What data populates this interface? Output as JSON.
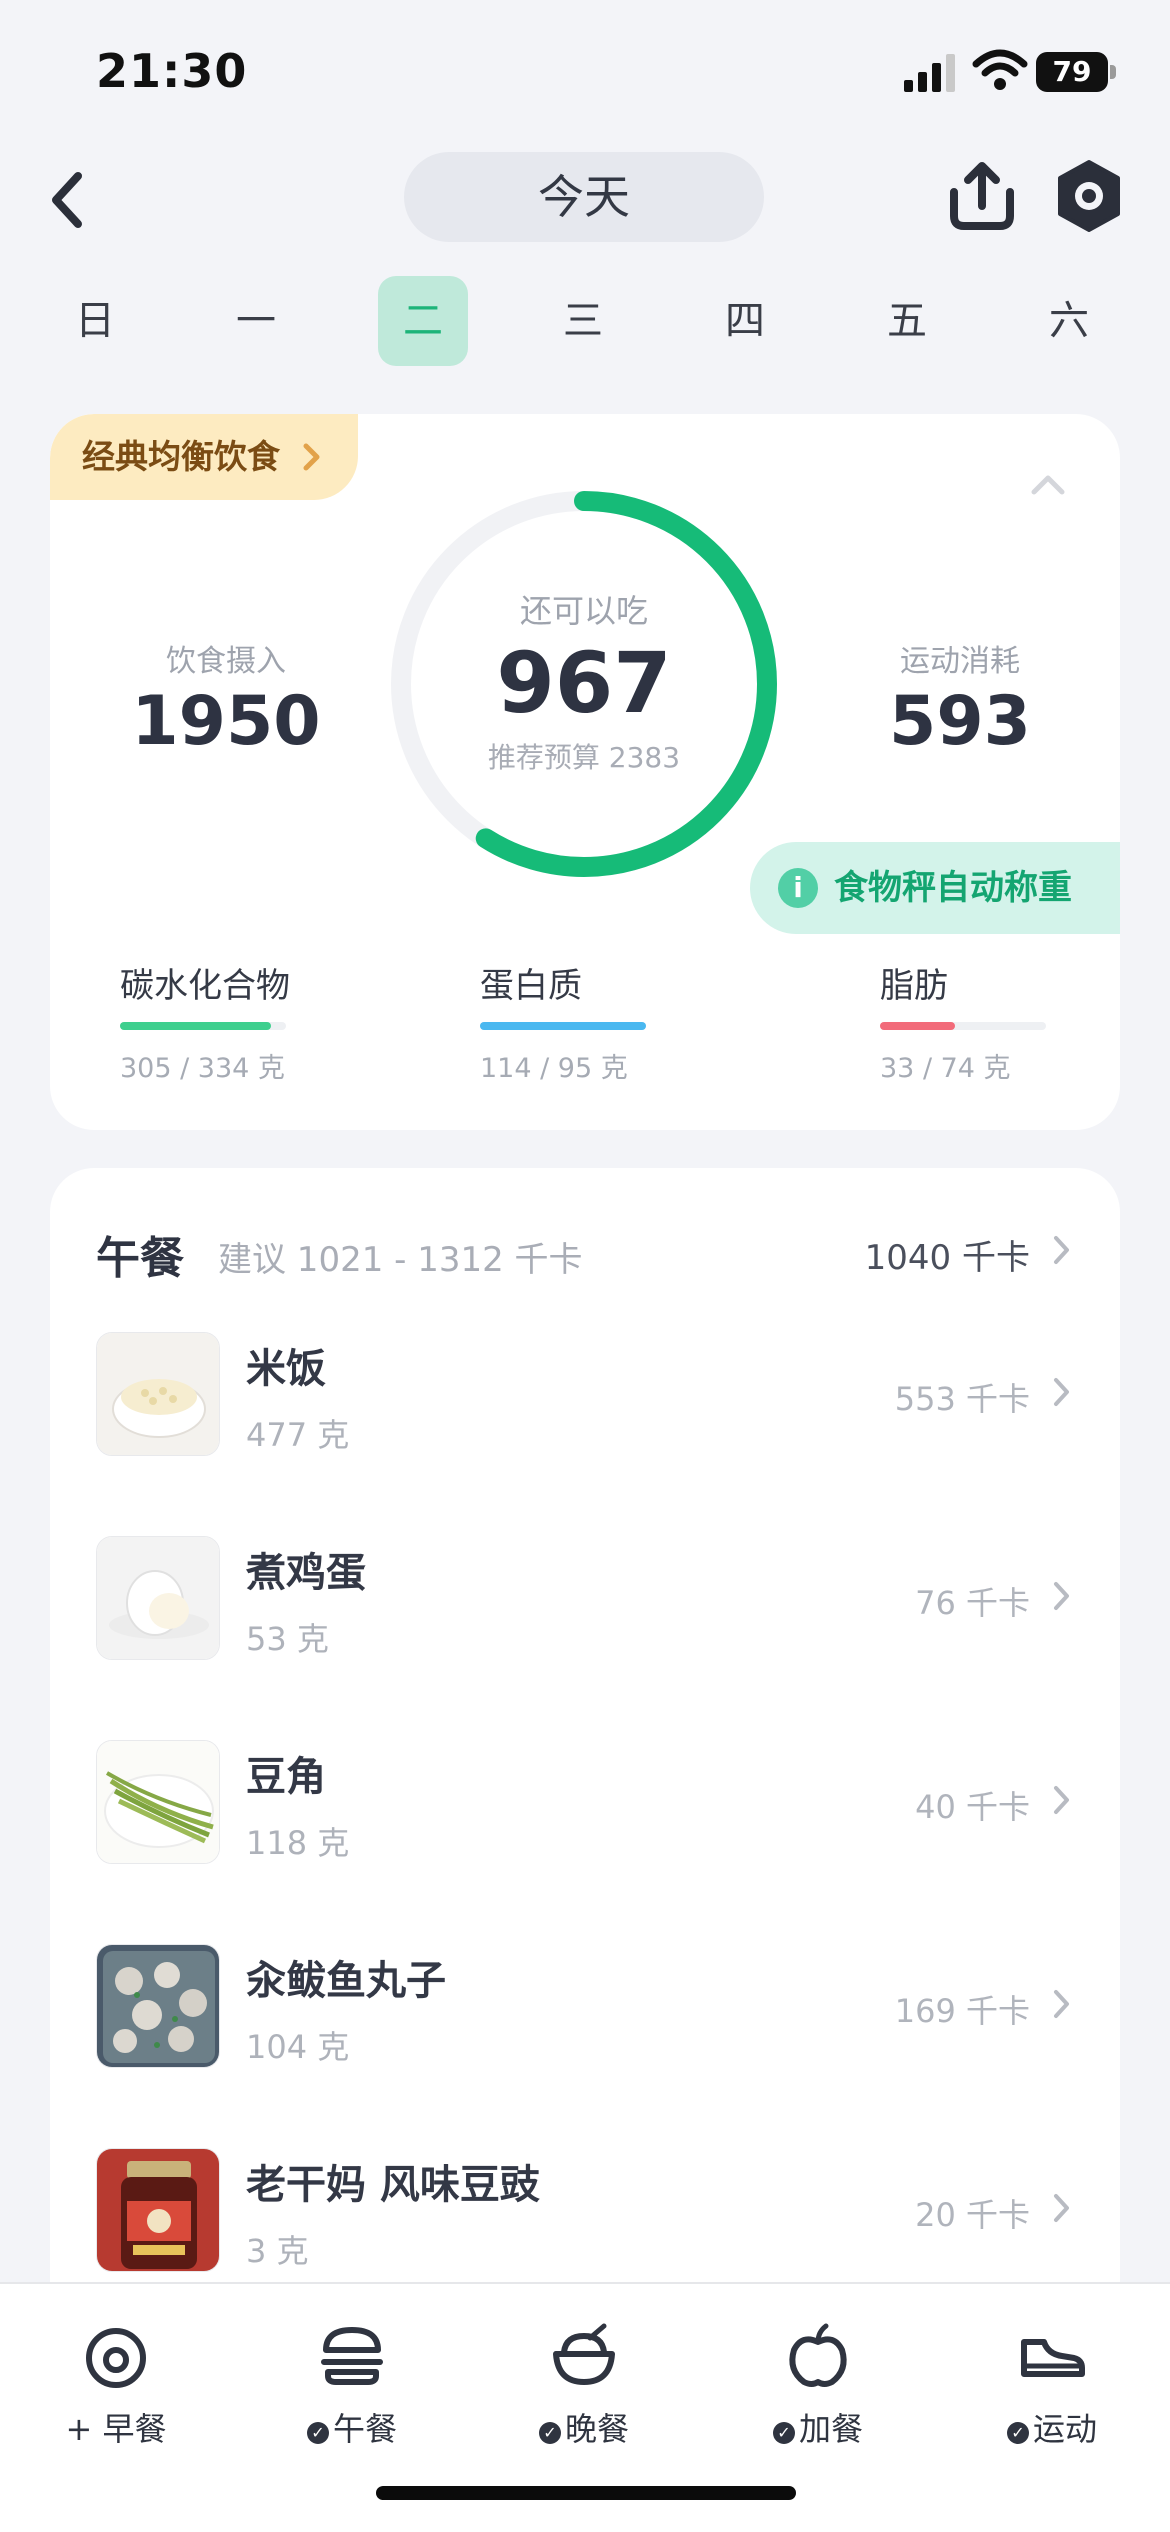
{
  "status_bar": {
    "time": "21:30",
    "battery": "79"
  },
  "header": {
    "title": "今天"
  },
  "week": {
    "days": [
      "日",
      "一",
      "二",
      "三",
      "四",
      "五",
      "六"
    ],
    "active_index": 2
  },
  "summary": {
    "diet_tag": "经典均衡饮食",
    "intake_label": "饮食摄入",
    "intake_value": "1950",
    "remaining_label": "还可以吃",
    "remaining_value": "967",
    "budget_text": "推荐预算 2383",
    "burn_label": "运动消耗",
    "burn_value": "593",
    "ring_progress": 0.59,
    "scale_button": "食物秤自动称重",
    "macros": [
      {
        "name": "碳水化合物",
        "value": "305 / 334 克",
        "progress": 0.91,
        "color": "#3ecf8e"
      },
      {
        "name": "蛋白质",
        "value": "114 / 95 克",
        "progress": 1.0,
        "color": "#4ab8f0"
      },
      {
        "name": "脂肪",
        "value": "33 / 74 克",
        "progress": 0.45,
        "color": "#f26b7a"
      }
    ]
  },
  "meal": {
    "title": "午餐",
    "hint": "建议 1021 - 1312 千卡",
    "total": "1040 千卡",
    "foods": [
      {
        "name": "米饭",
        "weight": "477 克",
        "kcal": "553 千卡",
        "icon": "rice-photo"
      },
      {
        "name": "煮鸡蛋",
        "weight": "53 克",
        "kcal": "76 千卡",
        "icon": "egg-photo"
      },
      {
        "name": "豆角",
        "weight": "118 克",
        "kcal": "40 千卡",
        "icon": "green-beans-photo"
      },
      {
        "name": "汆鲅鱼丸子",
        "weight": "104 克",
        "kcal": "169 千卡",
        "icon": "fish-balls-photo"
      },
      {
        "name": "老干妈 风味豆豉",
        "weight": "3 克",
        "kcal": "20 千卡",
        "icon": "sauce-jar-photo"
      }
    ]
  },
  "bottom_tabs": [
    {
      "label": "+ 早餐",
      "checked": false,
      "icon": "egg-icon"
    },
    {
      "label": "午餐",
      "checked": true,
      "icon": "burger-icon"
    },
    {
      "label": "晚餐",
      "checked": true,
      "icon": "bowl-icon"
    },
    {
      "label": "加餐",
      "checked": true,
      "icon": "apple-icon"
    },
    {
      "label": "运动",
      "checked": true,
      "icon": "sneaker-icon"
    }
  ]
}
